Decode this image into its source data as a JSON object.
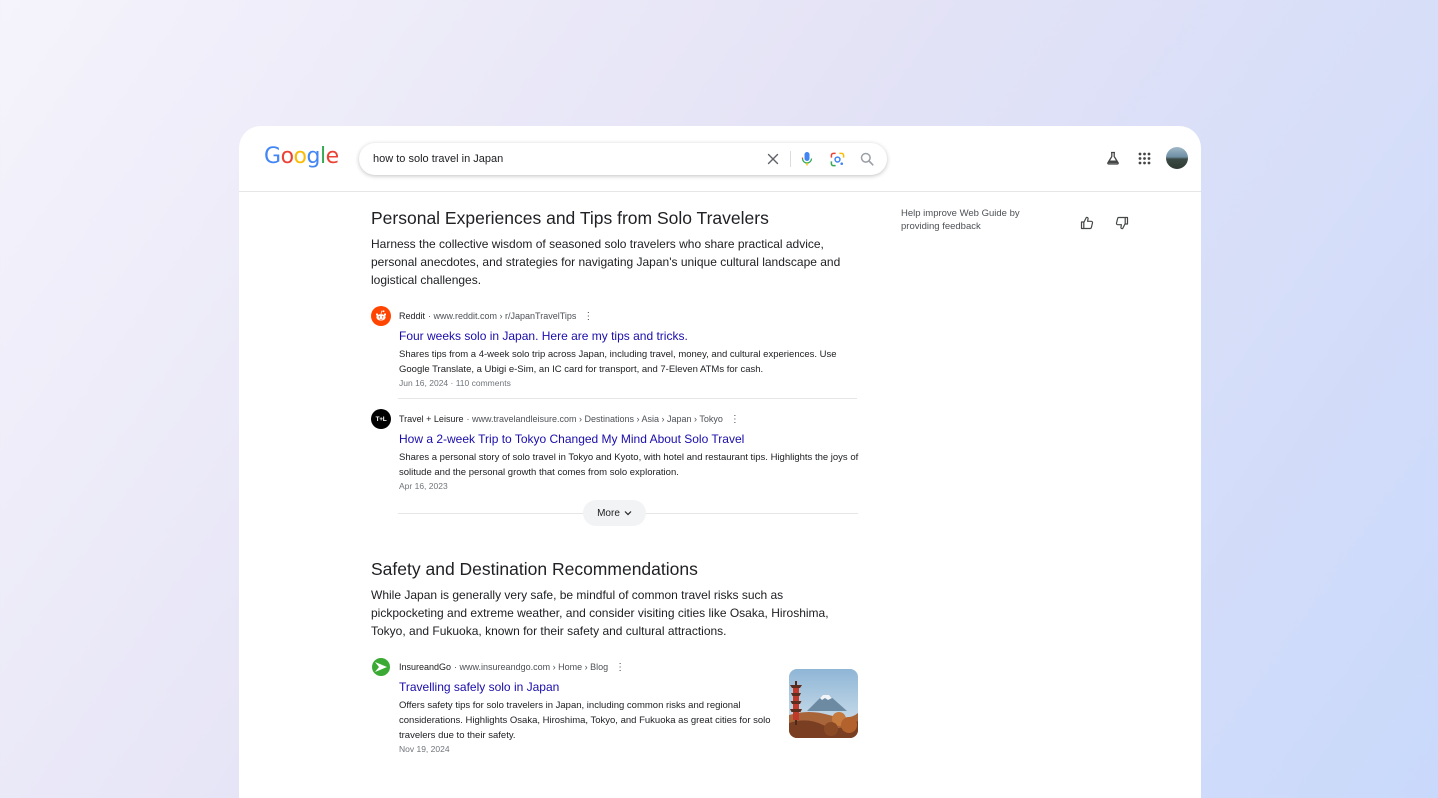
{
  "header": {
    "logo_letters": [
      {
        "ch": "G",
        "color": "#4285F4"
      },
      {
        "ch": "o",
        "color": "#EA4335"
      },
      {
        "ch": "o",
        "color": "#FBBC05"
      },
      {
        "ch": "g",
        "color": "#4285F4"
      },
      {
        "ch": "l",
        "color": "#34A853"
      },
      {
        "ch": "e",
        "color": "#EA4335"
      }
    ],
    "search": {
      "value": "how to solo travel in Japan"
    },
    "icons": [
      "clear-icon",
      "microphone-icon",
      "lens-icon",
      "search-icon",
      "labs-flask-icon",
      "apps-grid-icon",
      "avatar"
    ]
  },
  "feedback": {
    "text": "Help improve Web Guide by providing feedback",
    "icons": [
      "thumbs-up-icon",
      "thumbs-down-icon"
    ]
  },
  "sections": [
    {
      "title": "Personal Experiences and Tips from Solo Travelers",
      "description": "Harness the collective wisdom of seasoned solo travelers who share practical advice, personal anecdotes, and strategies for navigating Japan's unique cultural landscape and logistical challenges.",
      "more_label": "More",
      "results": [
        {
          "source": "Reddit",
          "url": "www.reddit.com › r/JapanTravelTips",
          "title": "Four weeks solo in Japan. Here are my tips and tricks.",
          "snippet": "Shares tips from a 4-week solo trip across Japan, including travel, money, and cultural experiences. Use Google Translate, a Ubigi e-Sim, an IC card for transport, and 7-Eleven ATMs for cash.",
          "meta": "Jun 16, 2024 · 110 comments",
          "favicon": "reddit-icon"
        },
        {
          "source": "Travel + Leisure",
          "url": "www.travelandleisure.com › Destinations › Asia › Japan › Tokyo",
          "title": "How a 2-week Trip to Tokyo Changed My Mind About Solo Travel",
          "snippet": "Shares a personal story of solo travel in Tokyo and Kyoto, with hotel and restaurant tips. Highlights the joys of solitude and the personal growth that comes from solo exploration.",
          "meta": "Apr 16, 2023",
          "favicon": "travel-leisure-icon",
          "favicon_text": "T+L"
        }
      ]
    },
    {
      "title": "Safety and Destination Recommendations",
      "description": "While Japan is generally very safe, be mindful of common travel risks such as pickpocketing and extreme weather, and consider visiting cities like Osaka, Hiroshima, Tokyo, and Fukuoka, known for their safety and cultural attractions.",
      "results": [
        {
          "source": "InsureandGo",
          "url": "www.insureandgo.com › Home › Blog",
          "title": "Travelling safely solo in Japan",
          "snippet": "Offers safety tips for solo travelers in Japan, including common risks and regional considerations. Highlights Osaka, Hiroshima, Tokyo, and Fukuoka as great cities for solo travelers due to their safety.",
          "meta": "Nov 19, 2024",
          "favicon": "insureandgo-icon",
          "thumbnail": "mount-fuji-pagoda-thumbnail"
        }
      ]
    }
  ]
}
